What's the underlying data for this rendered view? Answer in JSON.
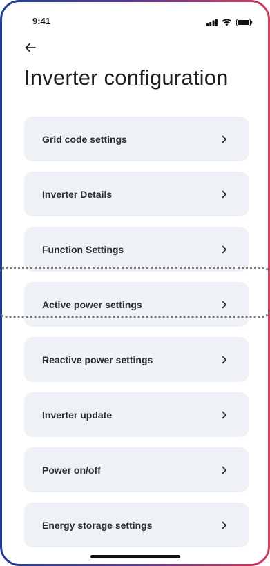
{
  "status_bar": {
    "time": "9:41"
  },
  "header": {
    "back_icon": "arrow-left-icon",
    "title": "Inverter configuration"
  },
  "menu": {
    "items": [
      {
        "label": "Grid code settings",
        "icon": "chevron-right-icon"
      },
      {
        "label": "Inverter Details",
        "icon": "chevron-right-icon"
      },
      {
        "label": "Function Settings",
        "icon": "chevron-right-icon"
      },
      {
        "label": "Active power settings",
        "icon": "chevron-right-icon",
        "highlighted": true
      },
      {
        "label": "Reactive power settings",
        "icon": "chevron-right-icon"
      },
      {
        "label": "Inverter update",
        "icon": "chevron-right-icon"
      },
      {
        "label": "Power on/off",
        "icon": "chevron-right-icon"
      },
      {
        "label": "Energy storage settings",
        "icon": "chevron-right-icon"
      }
    ]
  },
  "colors": {
    "frame_gradient_start": "#1f3f97",
    "frame_gradient_end": "#d63a5a",
    "card_background": "#eef1f5",
    "text_primary": "#2a2e35",
    "highlight_outline": "#7b7b7b"
  }
}
